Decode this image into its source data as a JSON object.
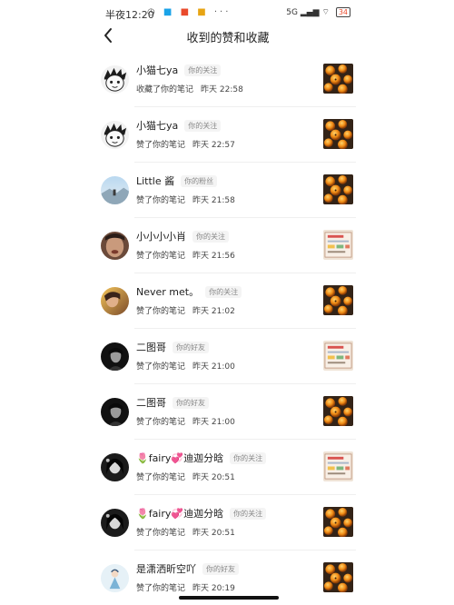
{
  "status_bar": {
    "time": "半夜12:20",
    "notification_icons": [
      "clock-icon",
      "app-icon",
      "app-icon",
      "app-icon",
      "more-icon"
    ],
    "network": "5G",
    "battery": "34"
  },
  "header": {
    "title": "收到的赞和收藏",
    "back_icon": "chevron-left-icon"
  },
  "notifications": [
    {
      "name": "小猫七ya",
      "relation": "你的关注",
      "action": "收藏了你的笔记",
      "time": "昨天 22:58",
      "avatar": "cartoon-face",
      "thumbnail": "fruit-photo"
    },
    {
      "name": "小猫七ya",
      "relation": "你的关注",
      "action": "赞了你的笔记",
      "time": "昨天 22:57",
      "avatar": "cartoon-face",
      "thumbnail": "fruit-photo"
    },
    {
      "name": "Little 酱",
      "relation": "你的粉丝",
      "action": "赞了你的笔记",
      "time": "昨天 21:58",
      "avatar": "landscape",
      "thumbnail": "fruit-photo"
    },
    {
      "name": "小小小小肖",
      "relation": "你的关注",
      "action": "赞了你的笔记",
      "time": "昨天 21:56",
      "avatar": "face-closeup",
      "thumbnail": "note-card"
    },
    {
      "name": "Never met。",
      "relation": "你的关注",
      "action": "赞了你的笔记",
      "time": "昨天 21:02",
      "avatar": "warm-portrait",
      "thumbnail": "fruit-photo"
    },
    {
      "name": "二图哥",
      "relation": "你的好友",
      "action": "赞了你的笔记",
      "time": "昨天 21:00",
      "avatar": "dark-portrait",
      "thumbnail": "note-card"
    },
    {
      "name": "二图哥",
      "relation": "你的好友",
      "action": "赞了你的笔记",
      "time": "昨天 21:00",
      "avatar": "dark-portrait",
      "thumbnail": "fruit-photo"
    },
    {
      "name": "🌷fairy💞迪迦分晗",
      "relation": "你的关注",
      "action": "赞了你的笔记",
      "time": "昨天 20:51",
      "avatar": "bw-portrait",
      "thumbnail": "note-card"
    },
    {
      "name": "🌷fairy💞迪迦分晗",
      "relation": "你的关注",
      "action": "赞了你的笔记",
      "time": "昨天 20:51",
      "avatar": "bw-portrait",
      "thumbnail": "fruit-photo"
    },
    {
      "name": "是潇洒昕空吖",
      "relation": "你的好友",
      "action": "赞了你的笔记",
      "time": "昨天 20:19",
      "avatar": "figure-illustration",
      "thumbnail": "fruit-photo"
    }
  ]
}
